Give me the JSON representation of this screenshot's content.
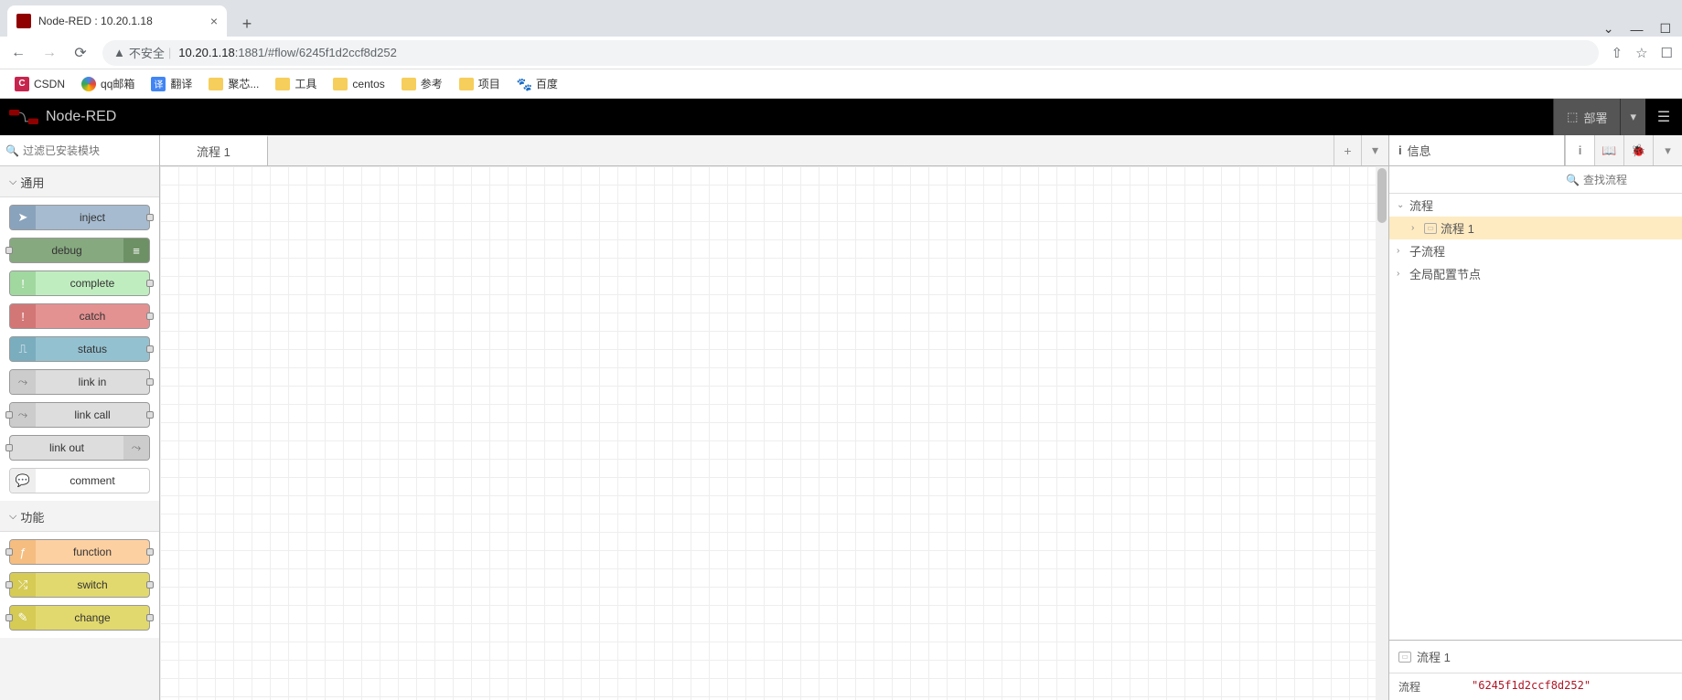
{
  "browser": {
    "tab_title": "Node-RED : 10.20.1.18",
    "insecure_label": "不安全",
    "url_host": "10.20.1.18",
    "url_port": ":1881",
    "url_path": "/#flow/6245f1d2ccf8d252"
  },
  "bookmarks": [
    {
      "label": "CSDN",
      "type": "c"
    },
    {
      "label": "qq邮箱",
      "type": "qq"
    },
    {
      "label": "翻译",
      "type": "tr"
    },
    {
      "label": "聚芯...",
      "type": "folder"
    },
    {
      "label": "工具",
      "type": "folder"
    },
    {
      "label": "centos",
      "type": "folder"
    },
    {
      "label": "参考",
      "type": "folder"
    },
    {
      "label": "项目",
      "type": "folder"
    },
    {
      "label": "百度",
      "type": "bd"
    }
  ],
  "header": {
    "app_name": "Node-RED",
    "deploy_label": "部署"
  },
  "palette": {
    "search_placeholder": "过滤已安装模块",
    "categories": [
      {
        "title": "通用",
        "nodes": [
          {
            "label": "inject",
            "cls": "n-inject",
            "icon": "➤",
            "ports": "out"
          },
          {
            "label": "debug",
            "cls": "n-debug",
            "icon": "≡",
            "icon_side": "right",
            "ports": "in"
          },
          {
            "label": "complete",
            "cls": "n-complete",
            "icon": "!",
            "ports": "out"
          },
          {
            "label": "catch",
            "cls": "n-catch",
            "icon": "!",
            "ports": "out"
          },
          {
            "label": "status",
            "cls": "n-status",
            "icon": "⎍",
            "ports": "out"
          },
          {
            "label": "link in",
            "cls": "n-link",
            "icon": "⤳",
            "ports": "out"
          },
          {
            "label": "link call",
            "cls": "n-link",
            "icon": "⤳",
            "ports": "both"
          },
          {
            "label": "link out",
            "cls": "n-link",
            "icon": "⤳",
            "icon_side": "right",
            "ports": "in"
          },
          {
            "label": "comment",
            "cls": "n-comment",
            "icon": "💬",
            "ports": "none"
          }
        ]
      },
      {
        "title": "功能",
        "nodes": [
          {
            "label": "function",
            "cls": "n-function",
            "icon": "ƒ",
            "ports": "both"
          },
          {
            "label": "switch",
            "cls": "n-switch",
            "icon": "⤮",
            "ports": "both"
          },
          {
            "label": "change",
            "cls": "n-change",
            "icon": "✎",
            "ports": "both"
          }
        ]
      }
    ]
  },
  "workspace": {
    "tabs": [
      {
        "label": "流程 1"
      }
    ]
  },
  "sidebar": {
    "info_label": "信息",
    "search_placeholder": "查找流程",
    "tree": {
      "flows_label": "流程",
      "flow1_label": "流程 1",
      "subflows_label": "子流程",
      "global_label": "全局配置节点"
    },
    "footer": {
      "title": "流程 1",
      "key": "流程",
      "value": "\"6245f1d2ccf8d252\""
    }
  }
}
